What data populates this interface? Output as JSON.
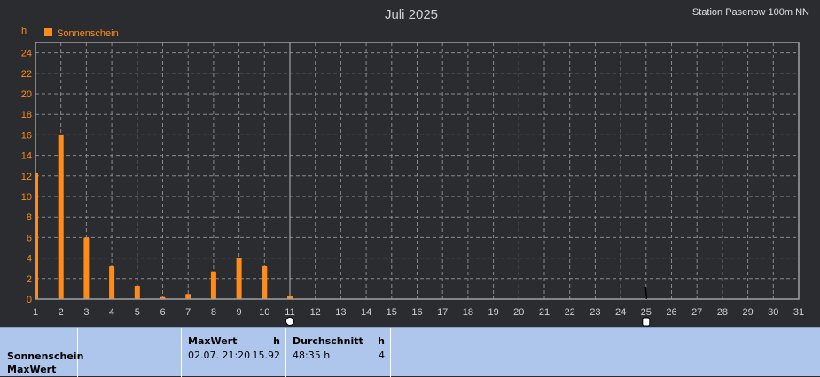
{
  "header": {
    "title": "Juli 2025",
    "station": "Station Pasenow 100m NN"
  },
  "chart_data": {
    "type": "bar",
    "title": "Juli 2025",
    "ylabel": "h",
    "xlim": [
      1,
      31
    ],
    "ylim": [
      0,
      25
    ],
    "yticks": [
      0,
      2,
      4,
      6,
      8,
      10,
      12,
      14,
      16,
      18,
      20,
      22,
      24
    ],
    "xticks": [
      1,
      2,
      3,
      4,
      5,
      6,
      7,
      8,
      9,
      10,
      11,
      12,
      13,
      14,
      15,
      16,
      17,
      18,
      19,
      20,
      21,
      22,
      23,
      24,
      25,
      26,
      27,
      28,
      29,
      30,
      31
    ],
    "grid": true,
    "legend": "top-left",
    "series": [
      {
        "name": "Sonnenschein",
        "color": "#ff8c1a",
        "x": [
          1,
          2,
          3,
          4,
          5,
          6,
          7,
          8,
          9,
          10,
          11
        ],
        "values": [
          12.3,
          16.0,
          6.0,
          3.2,
          1.3,
          0.2,
          0.5,
          2.7,
          4.0,
          3.2,
          0.3
        ]
      }
    ],
    "cursor_day": 11
  },
  "footer": {
    "label1": "Sonnenschein",
    "label2": "MaxWert",
    "max_header": "MaxWert",
    "max_unit": "h",
    "max_date": "02.07.  21:20",
    "max_value": "15.92",
    "avg_header": "Durchschnitt",
    "avg_unit": "h",
    "avg_value": "48:35 h",
    "avg_count": "4"
  },
  "colors": {
    "background": "#2a2c30",
    "axis_text": "#ff8c1a",
    "grid": "#8a8a8a",
    "bar": "#ff8c1a",
    "footer_bg": "#aec6ec"
  }
}
